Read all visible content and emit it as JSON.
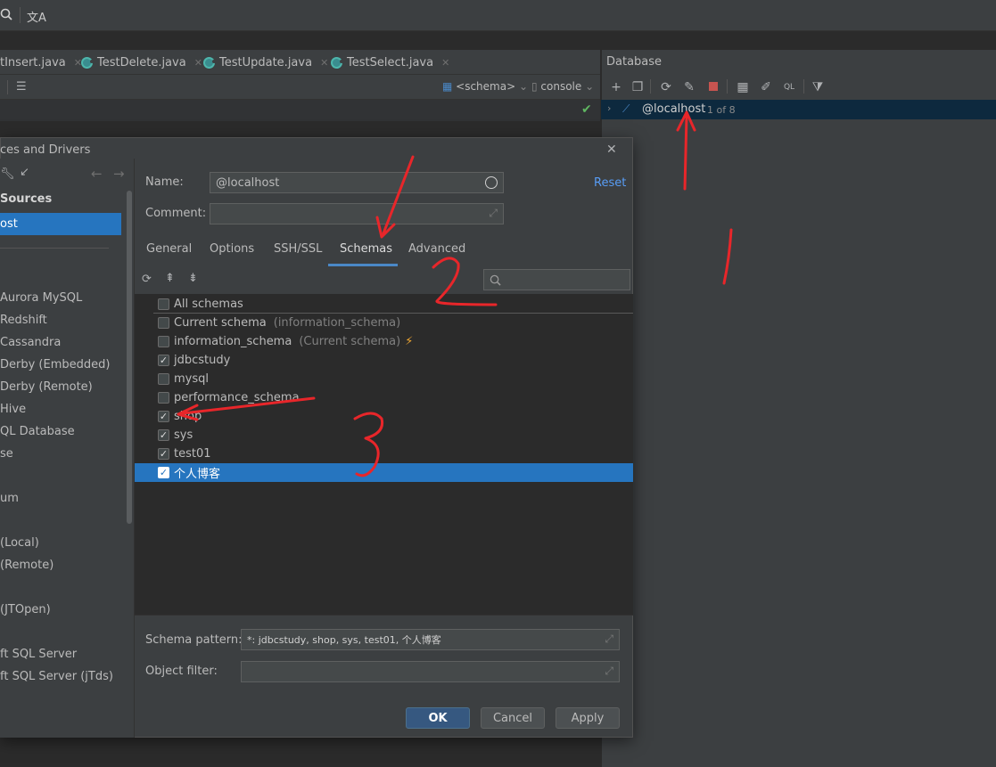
{
  "topbar": {
    "search_icon": "search-icon",
    "translate_icon": "translate-icon"
  },
  "editor_tabs": [
    {
      "label": "tInsert.java",
      "icon": "java-class-icon"
    },
    {
      "label": "TestDelete.java",
      "icon": "java-class-icon"
    },
    {
      "label": "TestUpdate.java",
      "icon": "java-class-icon"
    },
    {
      "label": "TestSelect.java",
      "icon": "java-class-icon"
    }
  ],
  "editor_toolbar": {
    "schema": "<schema>",
    "console": "console"
  },
  "database_panel": {
    "title": "Database",
    "tree_item": "@localhost",
    "tree_count": "1 of 8"
  },
  "dialog": {
    "title": "ces and Drivers",
    "left": {
      "section": "Sources",
      "selected": "ost",
      "drivers": [
        "Aurora MySQL",
        "Redshift",
        "Cassandra",
        "Derby (Embedded)",
        "Derby (Remote)",
        "Hive",
        "QL Database",
        "se",
        "um",
        "(Local)",
        "(Remote)",
        "(JTOpen)",
        "ft SQL Server",
        "ft SQL Server (jTds)"
      ]
    },
    "name_label": "Name:",
    "name_value": "@localhost",
    "comment_label": "Comment:",
    "reset": "Reset",
    "tabs": [
      "General",
      "Options",
      "SSH/SSL",
      "Schemas",
      "Advanced"
    ],
    "active_tab": "Schemas",
    "schemas": [
      {
        "name": "All schemas",
        "note": "",
        "checked": false
      },
      {
        "name": "Current schema",
        "note": "(information_schema)",
        "checked": false
      },
      {
        "name": "information_schema",
        "note": "(Current schema)",
        "checked": false
      },
      {
        "name": "jdbcstudy",
        "note": "",
        "checked": true
      },
      {
        "name": "mysql",
        "note": "",
        "checked": false
      },
      {
        "name": "performance_schema",
        "note": "",
        "checked": false
      },
      {
        "name": "shop",
        "note": "",
        "checked": true
      },
      {
        "name": "sys",
        "note": "",
        "checked": true
      },
      {
        "name": "test01",
        "note": "",
        "checked": true
      },
      {
        "name": "个人博客",
        "note": "",
        "checked": true
      }
    ],
    "schema_pattern_label": "Schema pattern:",
    "schema_pattern_value": "*: jdbcstudy, shop, sys, test01, 个人博客",
    "object_filter_label": "Object filter:",
    "object_filter_value": "",
    "buttons": {
      "ok": "OK",
      "cancel": "Cancel",
      "apply": "Apply"
    }
  },
  "annotations": [
    "1",
    "2",
    "3"
  ],
  "colors": {
    "accent": "#2675bf",
    "ok_button": "#365880",
    "annotation": "#e8262a"
  }
}
